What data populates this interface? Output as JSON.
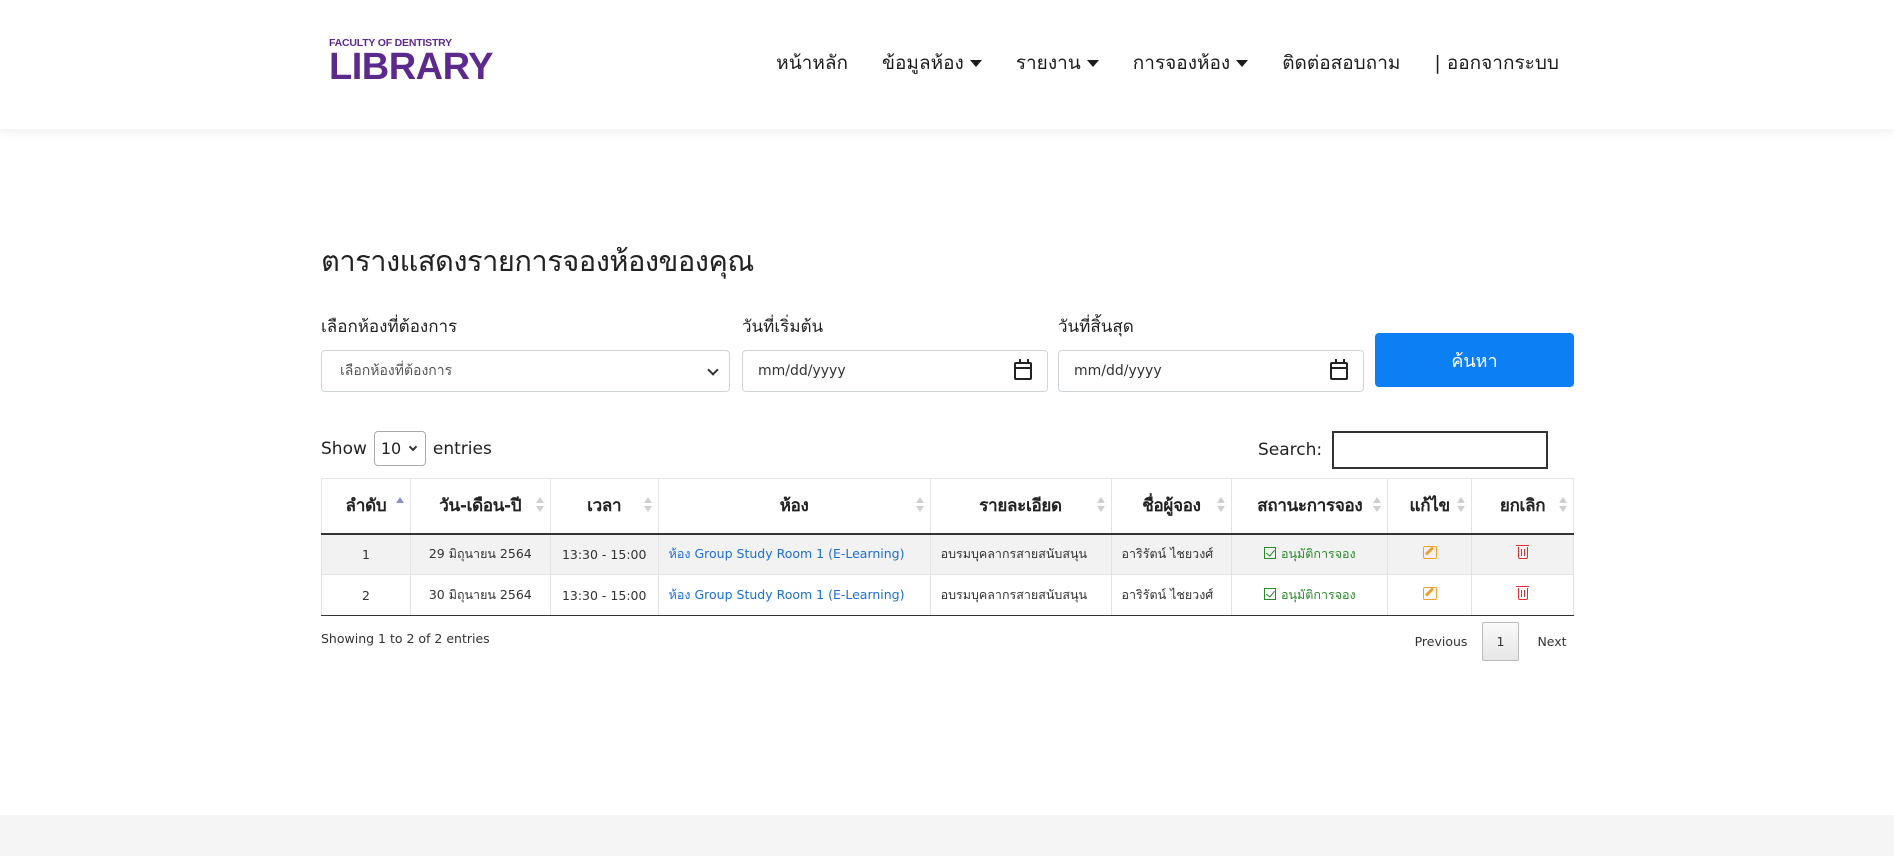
{
  "header": {
    "logo_small": "FACULTY OF DENTISTRY",
    "logo_big": "LIBRARY",
    "nav": [
      {
        "label": "หน้าหลัก",
        "dropdown": false
      },
      {
        "label": "ข้อมูลห้อง",
        "dropdown": true
      },
      {
        "label": "รายงาน",
        "dropdown": true
      },
      {
        "label": "การจองห้อง",
        "dropdown": true
      },
      {
        "label": "ติดต่อสอบถาม",
        "dropdown": false
      },
      {
        "label": "| ออกจากระบบ",
        "dropdown": false
      }
    ]
  },
  "main": {
    "title": "ตารางแสดงรายการจองห้องของคุณ",
    "room_label": "เลือกห้องที่ต้องการ",
    "room_select_value": "เลือกห้องที่ต้องการ",
    "start_label": "วันที่เริ่มต้น",
    "start_placeholder": "mm/dd/yyyy",
    "end_label": "วันที่สิ้นสุด",
    "end_placeholder": "mm/dd/yyyy",
    "search_button": "ค้นหา"
  },
  "table_controls": {
    "show_label": "Show",
    "entries_value": "10",
    "entries_label": "entries",
    "search_label": "Search:"
  },
  "table": {
    "headers": [
      "ลำดับ",
      "วัน-เดือน-ปี",
      "เวลา",
      "ห้อง",
      "รายละเอียด",
      "ชื่อผู้จอง",
      "สถานะการจอง",
      "แก้ไข",
      "ยกเลิก"
    ],
    "rows": [
      {
        "no": "1",
        "date": "29 มิถุนายน 2564",
        "time": "13:30 - 15:00",
        "room": "ห้อง Group Study Room 1 (E-Learning)",
        "detail": "อบรมบุคลากรสายสนับสนุน",
        "booker": "อาริรัตน์ ไชยวงศ์",
        "status": "อนุมัติการจอง"
      },
      {
        "no": "2",
        "date": "30 มิถุนายน 2564",
        "time": "13:30 - 15:00",
        "room": "ห้อง Group Study Room 1 (E-Learning)",
        "detail": "อบรมบุคลากรสายสนับสนุน",
        "booker": "อาริรัตน์ ไชยวงศ์",
        "status": "อนุมัติการจอง"
      }
    ],
    "info": "Showing 1 to 2 of 2 entries",
    "pagination": {
      "previous": "Previous",
      "current": "1",
      "next": "Next"
    }
  },
  "colors": {
    "brand": "#5b2a8c",
    "primary_button": "#0d7ff5",
    "link": "#1a6fd8",
    "status_approved": "#2a8a2a",
    "edit_icon": "#f0a030",
    "delete_icon": "#e03030"
  },
  "icons": [
    "calendar-icon",
    "chevron-down-icon",
    "check-square-icon",
    "edit-icon",
    "trash-icon"
  ]
}
